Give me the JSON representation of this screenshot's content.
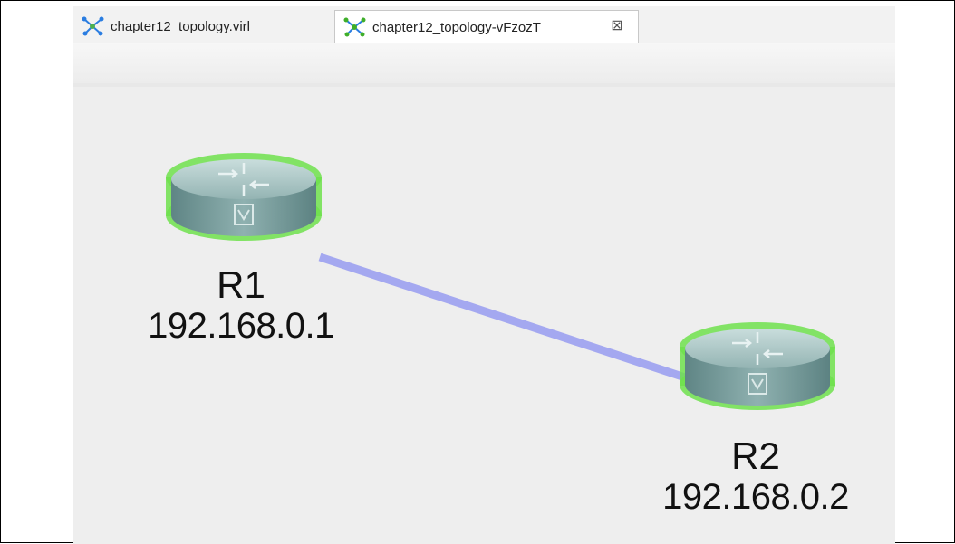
{
  "tabs": [
    {
      "label": "chapter12_topology.virl",
      "icon": "topology-icon",
      "active": false
    },
    {
      "label": "chapter12_topology-vFzozT",
      "icon": "topology-icon",
      "active": true,
      "close_icon": "close-tab-icon"
    }
  ],
  "topology": {
    "nodes": [
      {
        "name": "R1",
        "ip": "192.168.0.1",
        "icon": "router-icon",
        "status_color": "#7ed957"
      },
      {
        "name": "R2",
        "ip": "192.168.0.2",
        "icon": "router-icon",
        "status_color": "#7ed957"
      }
    ],
    "links": [
      {
        "from": "R1",
        "to": "R2",
        "color": "#a4a8f0"
      }
    ]
  }
}
